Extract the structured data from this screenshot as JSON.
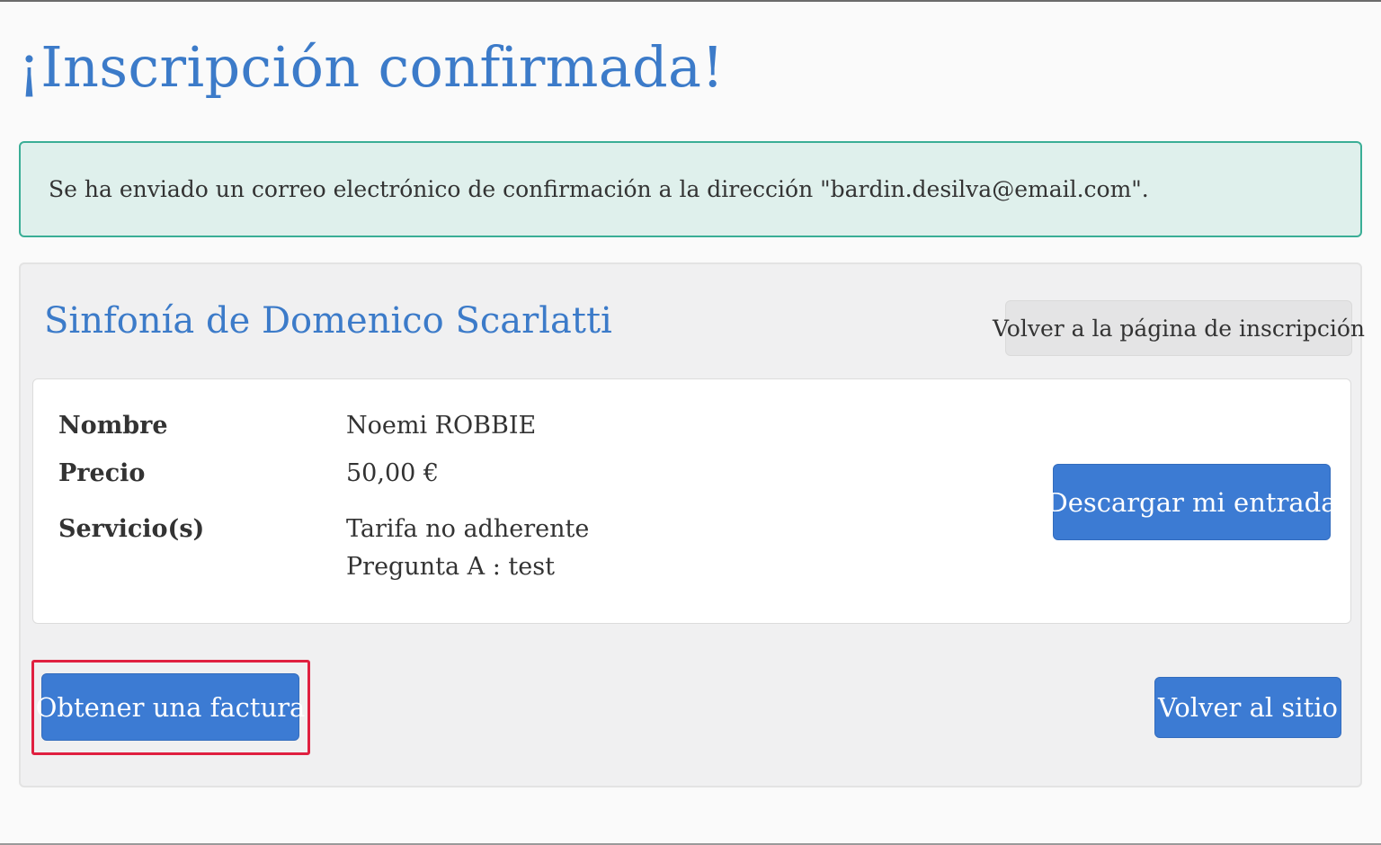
{
  "page": {
    "title": "¡Inscripción confirmada!"
  },
  "alert": {
    "message": "Se ha enviado un correo electrónico de confirmación a la dirección \"bardin.desilva@email.com\"."
  },
  "event": {
    "title": "Sinfonía de Domenico Scarlatti",
    "back_registration_label": "Volver a la página de inscripción",
    "details": {
      "name_label": "Nombre",
      "name_value": "Noemi ROBBIE",
      "price_label": "Precio",
      "price_value": "50,00 €",
      "services_label": "Servicio(s)",
      "services": [
        "Tarifa no adherente",
        "Pregunta A : test"
      ]
    },
    "download_ticket_label": "Descargar mi entrada",
    "invoice_label": "Obtener una factura",
    "back_site_label": "Volver al sitio"
  },
  "colors": {
    "title": "#3c7bc9",
    "primary_button": "#3c7bd3",
    "alert_background": "#dff0ec",
    "alert_border": "#3aae96",
    "highlight": "#e02040"
  }
}
